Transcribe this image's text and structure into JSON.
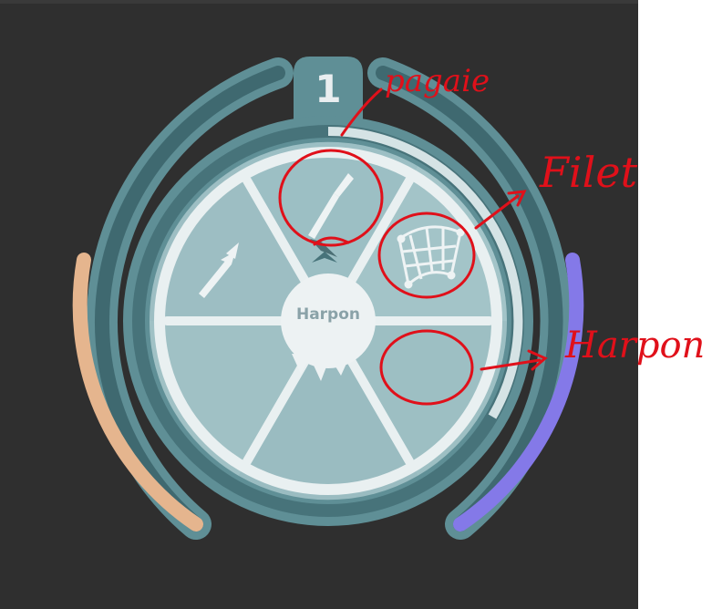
{
  "hud": {
    "slot_number": "1",
    "center_label": "Harpon",
    "selected_weapon": "pagaie",
    "left_gauge": {
      "fill": 0.62,
      "color": "#e5b58e"
    },
    "right_gauge": {
      "fill": 0.62,
      "color": "#8479e8"
    },
    "ring_progress": 0.3
  },
  "wheel": {
    "slots": [
      {
        "position": "top-left",
        "icon": "harpoon-dart-icon"
      },
      {
        "position": "top-center",
        "icon": "paddle-icon"
      },
      {
        "position": "top-right",
        "icon": "net-icon"
      },
      {
        "position": "bottom-right",
        "icon": ""
      },
      {
        "position": "bottom-center",
        "icon": ""
      },
      {
        "position": "bottom-left",
        "icon": ""
      }
    ]
  },
  "annotations": {
    "pagaie": "pagaie",
    "filet": "Filet",
    "harpon": "Harpon ."
  },
  "colors": {
    "background": "#2f2f2f",
    "frame": "#5f8f96",
    "frame_dark": "#47737a",
    "inner_disc": "#a6c6ca",
    "spokes": "#e9f0f1",
    "annotation": "#e0101a"
  }
}
